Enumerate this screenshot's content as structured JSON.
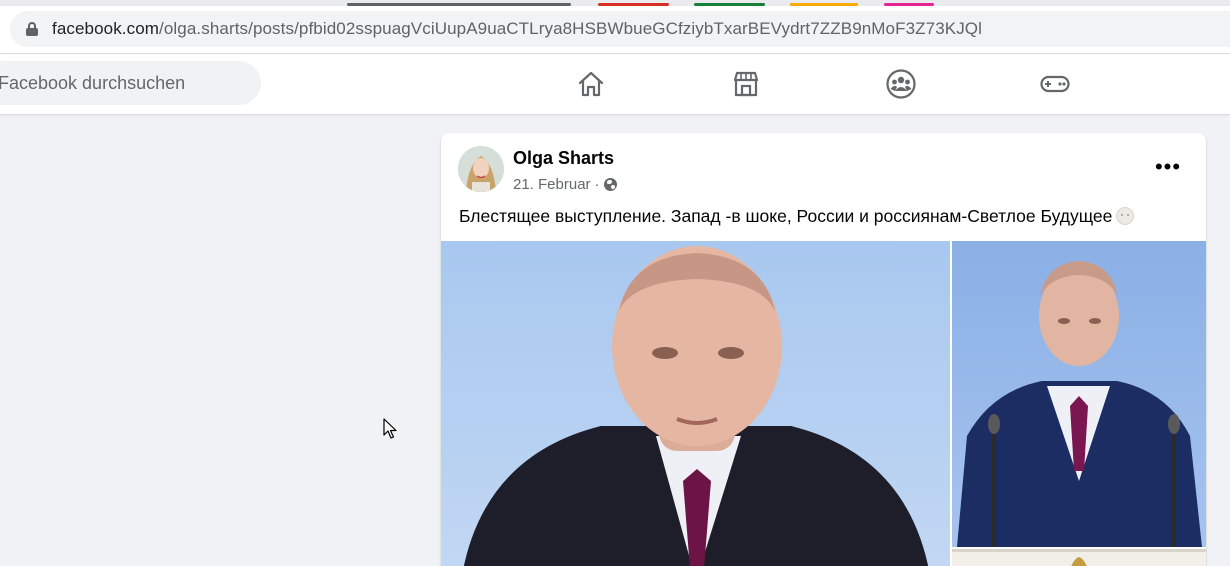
{
  "browser": {
    "url_domain": "facebook.com",
    "url_path": "/olga.sharts/posts/pfbid02sspuagVciUupA9uaCTLrya8HSBWbueGCfziybTxarBEVydrt7ZZB9nMoF3Z73KJQl"
  },
  "nav": {
    "search_placeholder": "Facebook durchsuchen",
    "icons": [
      "home-icon",
      "marketplace-icon",
      "groups-icon",
      "gaming-icon"
    ]
  },
  "post": {
    "author": "Olga Sharts",
    "date": "21. Februar",
    "separator": "·",
    "audience_icon": "globe-icon",
    "text": "Блестящее выступление. Запад -в шоке, России и россиянам-Светлое Будущее",
    "more_label": "•••"
  },
  "colors": {
    "page_bg": "#f0f2f5",
    "card_bg": "#ffffff",
    "text_primary": "#050505",
    "text_secondary": "#65676b"
  }
}
